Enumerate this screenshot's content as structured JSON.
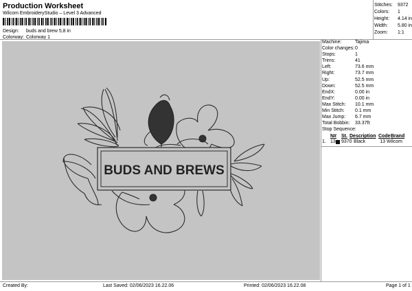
{
  "header": {
    "title": "Production Worksheet",
    "subtitle": "Wilcom EmbroideryStudio – Level 3 Advanced"
  },
  "design": {
    "design_label": "Design:",
    "design_value": "buds and brew 5,8 in",
    "colorway_label": "Colorway:",
    "colorway_value": "Colorway 1"
  },
  "stats": [
    {
      "label": "Stitches:",
      "value": "9372"
    },
    {
      "label": "Colors:",
      "value": "1"
    },
    {
      "label": "Height:",
      "value": "4.14 in"
    },
    {
      "label": "Width:",
      "value": "5.80 in"
    },
    {
      "label": "Zoom:",
      "value": "1:1"
    }
  ],
  "artwork": {
    "text": "BUDS AND BREWS",
    "thread_color": "#2b2b2b",
    "background": "#c4c4c4"
  },
  "machine": [
    {
      "label": "Machine:",
      "value": "Tajima"
    },
    {
      "label": "Color changes:",
      "value": "0"
    },
    {
      "label": "Stops:",
      "value": "1"
    },
    {
      "label": "Trims:",
      "value": "41"
    },
    {
      "label": "Left:",
      "value": "73.6 mm"
    },
    {
      "label": "Right:",
      "value": "73.7 mm"
    },
    {
      "label": "Up:",
      "value": "52.5 mm"
    },
    {
      "label": "Down:",
      "value": "52.5 mm"
    },
    {
      "label": "EndX:",
      "value": "0.00 in"
    },
    {
      "label": "EndY:",
      "value": "0.00 in"
    },
    {
      "label": "Max Stitch:",
      "value": "10.1 mm"
    },
    {
      "label": "Min Stitch:",
      "value": "0.1 mm"
    },
    {
      "label": "Max Jump:",
      "value": "6.7 mm"
    },
    {
      "label": "Total Bobbin:",
      "value": "33.37ft"
    }
  ],
  "stop_sequence": {
    "label": "Stop Sequence:",
    "headers": [
      "N#",
      "St.",
      "Description",
      "Code",
      "Brand"
    ],
    "rows": [
      {
        "index": "1.",
        "n": "13",
        "swatch": "#111111",
        "st": "9370",
        "description": "Black",
        "code": "13",
        "brand": "Wilcom"
      }
    ]
  },
  "footer": {
    "created_by": "Created By:",
    "last_saved": "Last Saved: 02/06/2023 16.22.06",
    "printed": "Printed: 02/06/2023 16.22.08",
    "page": "Page 1 of 1"
  }
}
